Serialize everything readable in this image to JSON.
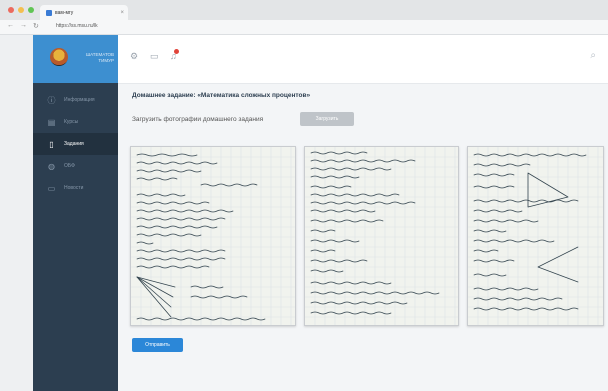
{
  "browser": {
    "tab_title": "вам-мгу",
    "tab_close": "×",
    "url": "https://ss.msu.ru/lk",
    "back": "←",
    "forward": "→",
    "reload": "↻"
  },
  "sidebar": {
    "user_name": "ШАТЕМАТОВ ТИМУР",
    "items": [
      {
        "label": "Информация",
        "icon": "info-icon",
        "glyph": "ⓘ",
        "active": false
      },
      {
        "label": "Курсы",
        "icon": "book-icon",
        "glyph": "▤",
        "active": false
      },
      {
        "label": "Задания",
        "icon": "document-icon",
        "glyph": "▯",
        "active": true
      },
      {
        "label": "ОБФ",
        "icon": "globe-icon",
        "glyph": "◍",
        "active": false
      },
      {
        "label": "Новости",
        "icon": "file-icon",
        "glyph": "▭",
        "active": false
      }
    ]
  },
  "topbar": {
    "icons": [
      "settings-icon",
      "chat-icon",
      "bell-icon",
      "search-icon"
    ]
  },
  "main": {
    "title": "Домашнее задание: «Математика сложных процентов»",
    "upload_label": "Загрузить фотографии домашнего задания",
    "upload_button": "Загрузить",
    "submit_button": "Отправить"
  },
  "colors": {
    "sidebar": "#2c3e50",
    "profile": "#3d8fd0",
    "accent": "#2b87d8",
    "notification": "#e0443a"
  }
}
